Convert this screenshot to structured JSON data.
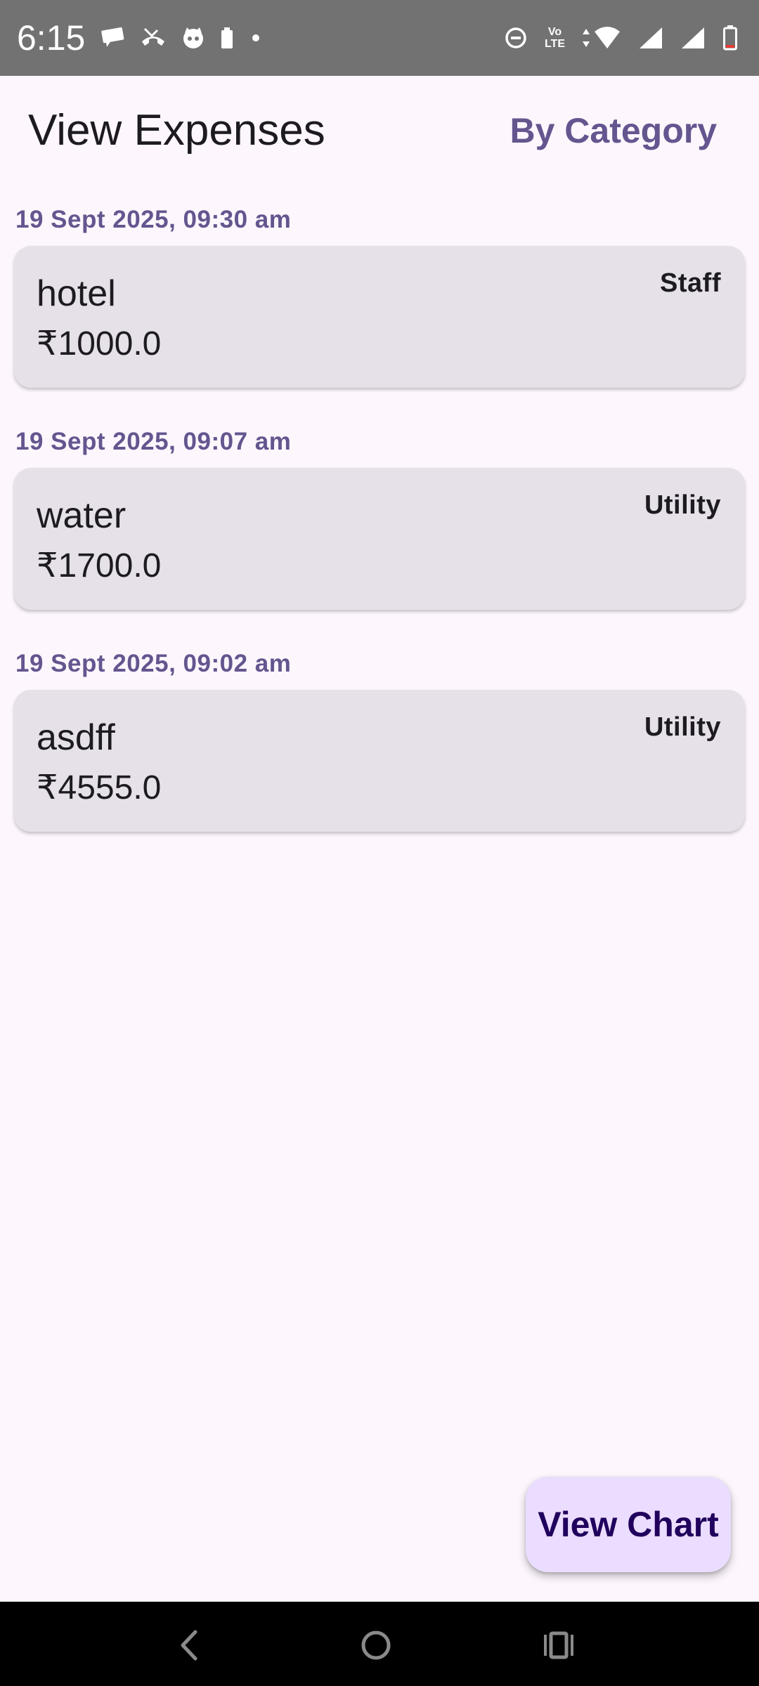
{
  "status_bar": {
    "time": "6:15",
    "volte_line1": "Vo",
    "volte_line2": "LTE",
    "icons_left": [
      "chat-icon",
      "missed-call-icon",
      "cat-icon",
      "battery-saver-icon",
      "dot-icon"
    ],
    "icons_right": [
      "do-not-disturb-icon",
      "volte-icon",
      "data-arrows-icon",
      "wifi-icon",
      "signal-icon",
      "signal-icon",
      "battery-low-icon"
    ]
  },
  "app_bar": {
    "title": "View Expenses",
    "by_category_label": "By Category"
  },
  "expenses": [
    {
      "date": "19 Sept 2025, 09:30 am",
      "name": "hotel",
      "amount": "₹1000.0",
      "category": "Staff"
    },
    {
      "date": "19 Sept 2025, 09:07 am",
      "name": "water",
      "amount": "₹1700.0",
      "category": "Utility"
    },
    {
      "date": "19 Sept 2025, 09:02 am",
      "name": "asdff",
      "amount": "₹4555.0",
      "category": "Utility"
    }
  ],
  "fab": {
    "label": "View Chart"
  },
  "nav_bar": {
    "icons": [
      "back-icon",
      "home-icon",
      "recents-icon"
    ]
  },
  "colors": {
    "background": "#FDF7FD",
    "accent": "#65558F",
    "card": "#E6E0E9",
    "fab": "#EADDFF",
    "fab_text": "#21005D",
    "status_bar": "#727272",
    "battery_low": "#E53935"
  }
}
